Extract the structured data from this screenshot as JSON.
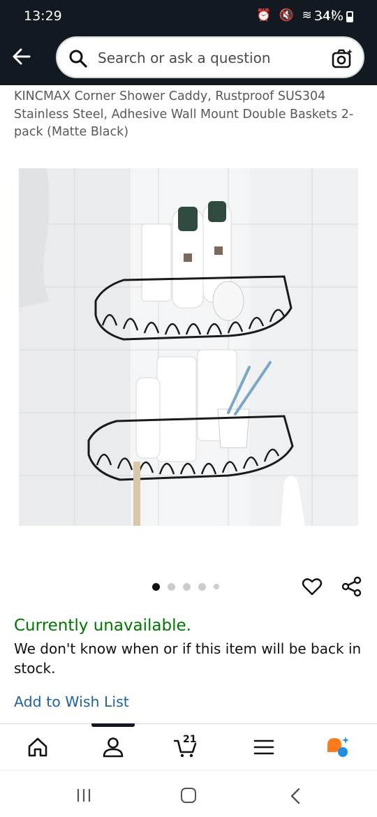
{
  "status_bar": {
    "time": "13:29",
    "icons": "⏰ 🔇 ≋ .ıl",
    "battery": "34%"
  },
  "search": {
    "placeholder": "Search or ask a question"
  },
  "product": {
    "title": "KINCMAX Corner Shower Caddy, Rustproof SUS304 Stainless Steel, Adhesive Wall Mount Double Baskets 2-pack (Matte Black)",
    "image_count": 5,
    "active_image": 1,
    "availability": "Currently unavailable.",
    "stock_message": "We don't know when or if this item will be back in stock.",
    "wishlist_label": "Add to Wish List"
  },
  "bottom_nav": {
    "items": [
      "home-icon",
      "account-icon",
      "cart-icon",
      "menu-icon",
      "rufus-icon"
    ],
    "active": "account-icon",
    "cart_count": "21"
  },
  "colors": {
    "header_bg": "#131921",
    "availability": "#007600",
    "link": "#2162a1",
    "title_text": "#565959"
  }
}
